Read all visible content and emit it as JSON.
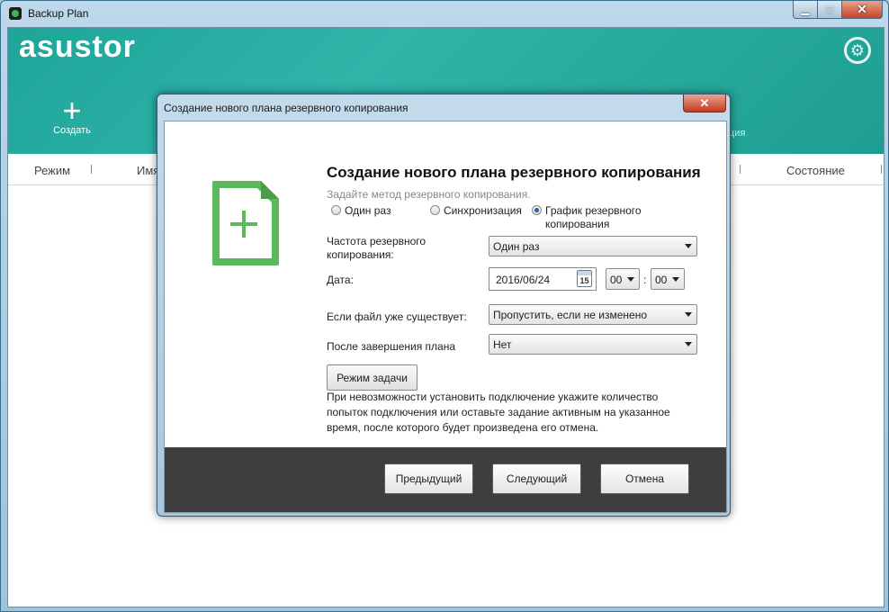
{
  "window": {
    "title": "Backup Plan",
    "controls": {
      "minimize": "▁",
      "maximize": "□",
      "close": "✕"
    }
  },
  "app": {
    "logo": "asustor",
    "create_label": "Создать",
    "partial_header_label": "ция"
  },
  "columns": [
    "Режим",
    "Имя",
    "Состояние"
  ],
  "dialog": {
    "title": "Создание нового плана резервного копирования",
    "heading": "Создание нового плана резервного копирования",
    "subtitle": "Задайте метод резервного копирования.",
    "methods": [
      {
        "label": "Один раз",
        "selected": false
      },
      {
        "label": "Синхронизация",
        "selected": false
      },
      {
        "label": "График резервного копирования",
        "selected": true
      }
    ],
    "frequency": {
      "label": "Частота резервного копирования:",
      "value": "Один раз"
    },
    "date": {
      "label": "Дата:",
      "value": "2016/06/24",
      "calendar_day": "15",
      "hour": "00",
      "minute": "00",
      "separator": ":"
    },
    "if_exists": {
      "label": "Если файл уже существует:",
      "value": "Пропустить, если не изменено"
    },
    "after_plan": {
      "label": "После завершения плана",
      "value": "Нет"
    },
    "task_mode_button": "Режим задачи",
    "note": "При невозможности установить подключение укажите количество попыток подключения или оставьте задание активным на указанное время, после которого будет произведена его отмена.",
    "buttons": {
      "previous": "Предыдущий",
      "next": "Следующий",
      "cancel": "Отмена"
    },
    "close_glyph": "✕",
    "icon_color": "#5cb85c"
  },
  "colors": {
    "header": "#23a89c",
    "accent_green": "#5cb85c",
    "footer": "#3e3e3e"
  }
}
